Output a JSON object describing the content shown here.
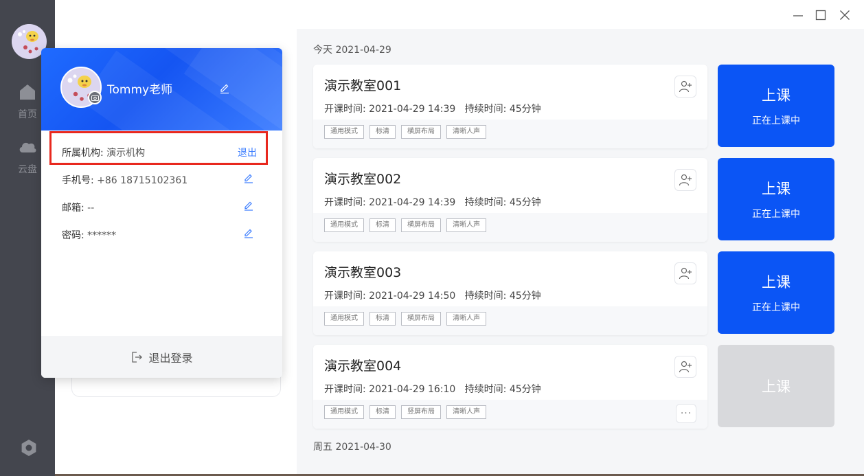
{
  "sidebar": {
    "items": [
      {
        "label": "首页",
        "icon": "home-icon"
      },
      {
        "label": "云盘",
        "icon": "cloud-icon"
      }
    ],
    "settings_icon": "settings-icon"
  },
  "profile": {
    "username": "Tommy老师",
    "org_label": "所属机构:",
    "org_value": "演示机构",
    "org_logout": "退出",
    "phone_label": "手机号:",
    "phone_value": "+86 18715102361",
    "email_label": "邮箱:",
    "email_value": "--",
    "password_label": "密码:",
    "password_value": "******",
    "logout_label": "退出登录",
    "highlight_color": "#e8281e"
  },
  "schedule": {
    "today_label": "今天 2021-04-29",
    "next_day_label": "周五 2021-04-30",
    "classes": [
      {
        "name": "演示教室001",
        "time": "开课时间: 2021-04-29 14:39   持续时间: 45分钟",
        "tags": [
          "通用模式",
          "标清",
          "横屏布局",
          "清晰人声"
        ],
        "button": "上课",
        "status": "正在上课中",
        "active": true
      },
      {
        "name": "演示教室002",
        "time": "开课时间: 2021-04-29 14:39   持续时间: 45分钟",
        "tags": [
          "通用模式",
          "标清",
          "横屏布局",
          "清晰人声"
        ],
        "button": "上课",
        "status": "正在上课中",
        "active": true
      },
      {
        "name": "演示教室003",
        "time": "开课时间: 2021-04-29 14:50   持续时间: 45分钟",
        "tags": [
          "通用模式",
          "标清",
          "横屏布局",
          "清晰人声"
        ],
        "button": "上课",
        "status": "正在上课中",
        "active": true
      },
      {
        "name": "演示教室004",
        "time": "开课时间: 2021-04-29 16:10   持续时间: 45分钟",
        "tags": [
          "通用模式",
          "标清",
          "竖屏布局",
          "清晰人声"
        ],
        "button": "上课",
        "status": "",
        "active": false
      }
    ]
  },
  "colors": {
    "accent": "#0b55f5",
    "sidebar": "#44464e",
    "disabled": "#d8d9dc"
  }
}
